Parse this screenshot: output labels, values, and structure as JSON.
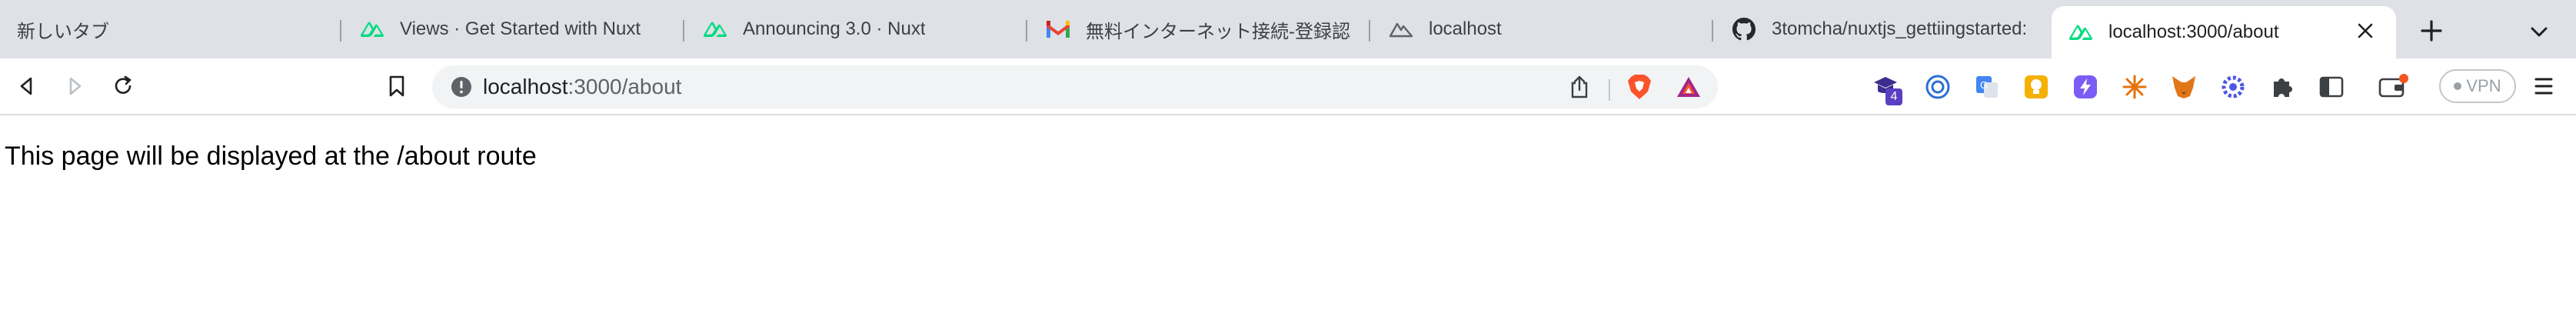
{
  "tabs": [
    {
      "title": "新しいタブ",
      "icon": "none",
      "active": false
    },
    {
      "title": "Views · Get Started with Nuxt",
      "icon": "nuxt-icon",
      "active": false
    },
    {
      "title": "Announcing 3.0 · Nuxt",
      "icon": "nuxt-icon",
      "active": false
    },
    {
      "title": "無料インターネット接続-登録認証×",
      "icon": "gmail-icon",
      "active": false
    },
    {
      "title": "localhost",
      "icon": "nuxt-gray-icon",
      "active": false
    },
    {
      "title": "3tomcha/nuxtjs_gettiingstarted:",
      "icon": "github-icon",
      "active": false
    },
    {
      "title": "localhost:3000/about",
      "icon": "nuxt-icon",
      "active": true
    }
  ],
  "toolbar": {
    "url_host": "localhost",
    "url_path": ":3000/about",
    "vpn_label": "VPN",
    "extension_badge": "4"
  },
  "colors": {
    "nuxt_green": "#00dc82",
    "brave_orange": "#fb542b",
    "tabstrip_bg": "#dee1e6",
    "wallet_badge": "#f4541f"
  },
  "page": {
    "text": "This page will be displayed at the /about route"
  }
}
